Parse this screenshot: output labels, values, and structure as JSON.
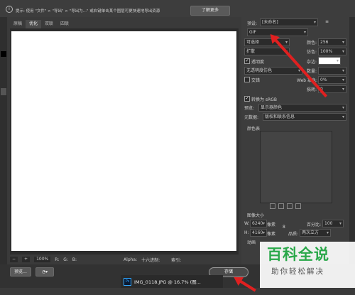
{
  "topbar": {
    "tip": "提示: 使用 \"文件\" > \"导出\" > \"导出为...\" 或右键单击某个图层可更快速地导出资源",
    "learn_more": "了解更多"
  },
  "tabs": [
    "原稿",
    "优化",
    "双联",
    "四联"
  ],
  "status": {
    "zoom": "100%",
    "r": "R:",
    "g": "G:",
    "b": "B:",
    "alpha": "Alpha:",
    "hex": "十六进制:",
    "index": "索引:"
  },
  "bottom": {
    "preview": "预览...",
    "save": "存储"
  },
  "taskbar": {
    "item": "IMG_0118.JPG @ 16.7% (图..."
  },
  "panel": {
    "preset_label": "预设:",
    "preset_value": "[未命名]",
    "format": "GIF",
    "palette": "可选择",
    "colors_label": "颜色:",
    "colors_value": "256",
    "dither_alg": "扩散",
    "dither_label": "仿色:",
    "dither_value": "100%",
    "transparency": "透明度",
    "matte_label": "杂边:",
    "transparency_dither": "无透明度仿色",
    "amount_label": "数量:",
    "interlaced": "交错",
    "websnap_label": "Web 靠色:",
    "websnap_value": "0%",
    "lossy_label": "损耗:",
    "lossy_value": "0",
    "convert_srgb": "转换为 sRGB",
    "preview_label": "预览:",
    "preview_value": "显示器颜色",
    "metadata_label": "元数据:",
    "metadata_value": "版权和联系信息",
    "color_table": "颜色表",
    "image_size": "图像大小",
    "w_label": "W:",
    "w_value": "6240",
    "h_label": "H:",
    "h_value": "4160",
    "unit": "像素",
    "percent_label": "百分比:",
    "percent_value": "100",
    "quality_label": "品质:",
    "quality_value": "两次立方",
    "animation": "动画"
  },
  "watermark": {
    "title": "百科全说",
    "sub": "助你轻松解决"
  },
  "colors": {
    "arrow": "#e02020",
    "watermark_green": "#2aa84a"
  }
}
